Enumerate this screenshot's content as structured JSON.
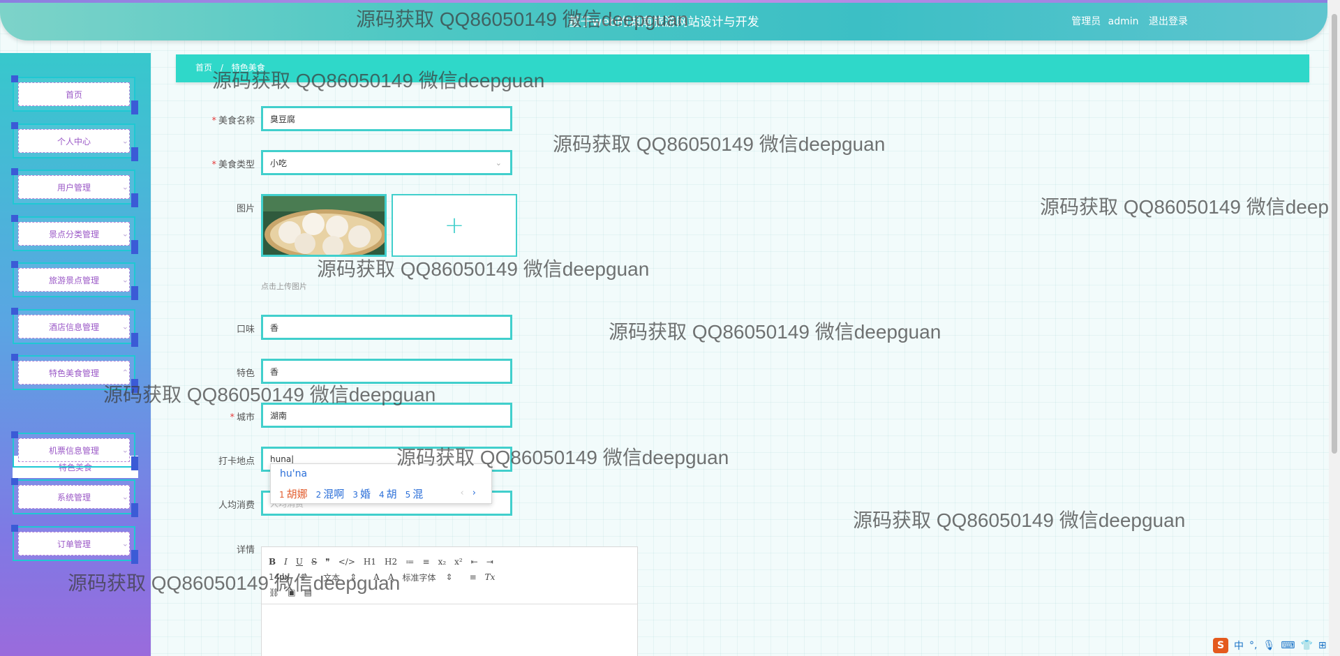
{
  "header": {
    "title": "基于web的湖南旅游网站设计与开发",
    "user_role": "管理员",
    "username": "admin",
    "logout": "退出登录"
  },
  "sidebar": {
    "items": [
      {
        "label": "首页",
        "has_chevron": false
      },
      {
        "label": "个人中心",
        "has_chevron": true
      },
      {
        "label": "用户管理",
        "has_chevron": true
      },
      {
        "label": "景点分类管理",
        "has_chevron": true
      },
      {
        "label": "旅游景点管理",
        "has_chevron": true
      },
      {
        "label": "酒店信息管理",
        "has_chevron": true
      },
      {
        "label": "特色美食管理",
        "has_chevron": true,
        "expanded": true
      },
      {
        "label": "机票信息管理",
        "has_chevron": true
      },
      {
        "label": "系统管理",
        "has_chevron": true
      },
      {
        "label": "订单管理",
        "has_chevron": true
      }
    ],
    "sub_item": "特色美食"
  },
  "breadcrumb": {
    "home": "首页",
    "separator": "/",
    "current": "特色美食"
  },
  "form": {
    "name": {
      "label": "美食名称",
      "value": "臭豆腐",
      "required": true
    },
    "type": {
      "label": "美食类型",
      "value": "小吃",
      "required": true
    },
    "image": {
      "label": "图片",
      "tip": "点击上传图片"
    },
    "taste": {
      "label": "口味",
      "value": "香"
    },
    "feature": {
      "label": "特色",
      "value": "香"
    },
    "city": {
      "label": "城市",
      "value": "湖南",
      "required": true
    },
    "checkin": {
      "label": "打卡地点",
      "value": "huna"
    },
    "avg_cost": {
      "label": "人均消费",
      "placeholder": "人均消费"
    },
    "detail": {
      "label": "详情"
    }
  },
  "ime": {
    "pinyin": "hu'na",
    "candidates": [
      {
        "n": "1",
        "text": "胡娜"
      },
      {
        "n": "2",
        "text": "混啊"
      },
      {
        "n": "3",
        "text": "婚"
      },
      {
        "n": "4",
        "text": "胡"
      },
      {
        "n": "5",
        "text": "混"
      }
    ],
    "prev": "‹",
    "next": "›"
  },
  "editor": {
    "row1": [
      "B",
      "I",
      "U",
      "S",
      "❞",
      "</>",
      "H1",
      "H2",
      "≔",
      "≡",
      "x₂",
      "x²",
      "⇤",
      "⇥"
    ],
    "size": "14px",
    "text": "文本",
    "font": "标准字体",
    "align": "≡",
    "clear": "Tx"
  },
  "watermark": "源码获取 QQ86050149 微信deepguan",
  "tray": {
    "lang": "中",
    "punct": "°,"
  },
  "colors": {
    "accent": "#2fd8c9",
    "border": "#41cfcc",
    "menu_text": "#9b59c7",
    "required": "#e53b3b"
  }
}
